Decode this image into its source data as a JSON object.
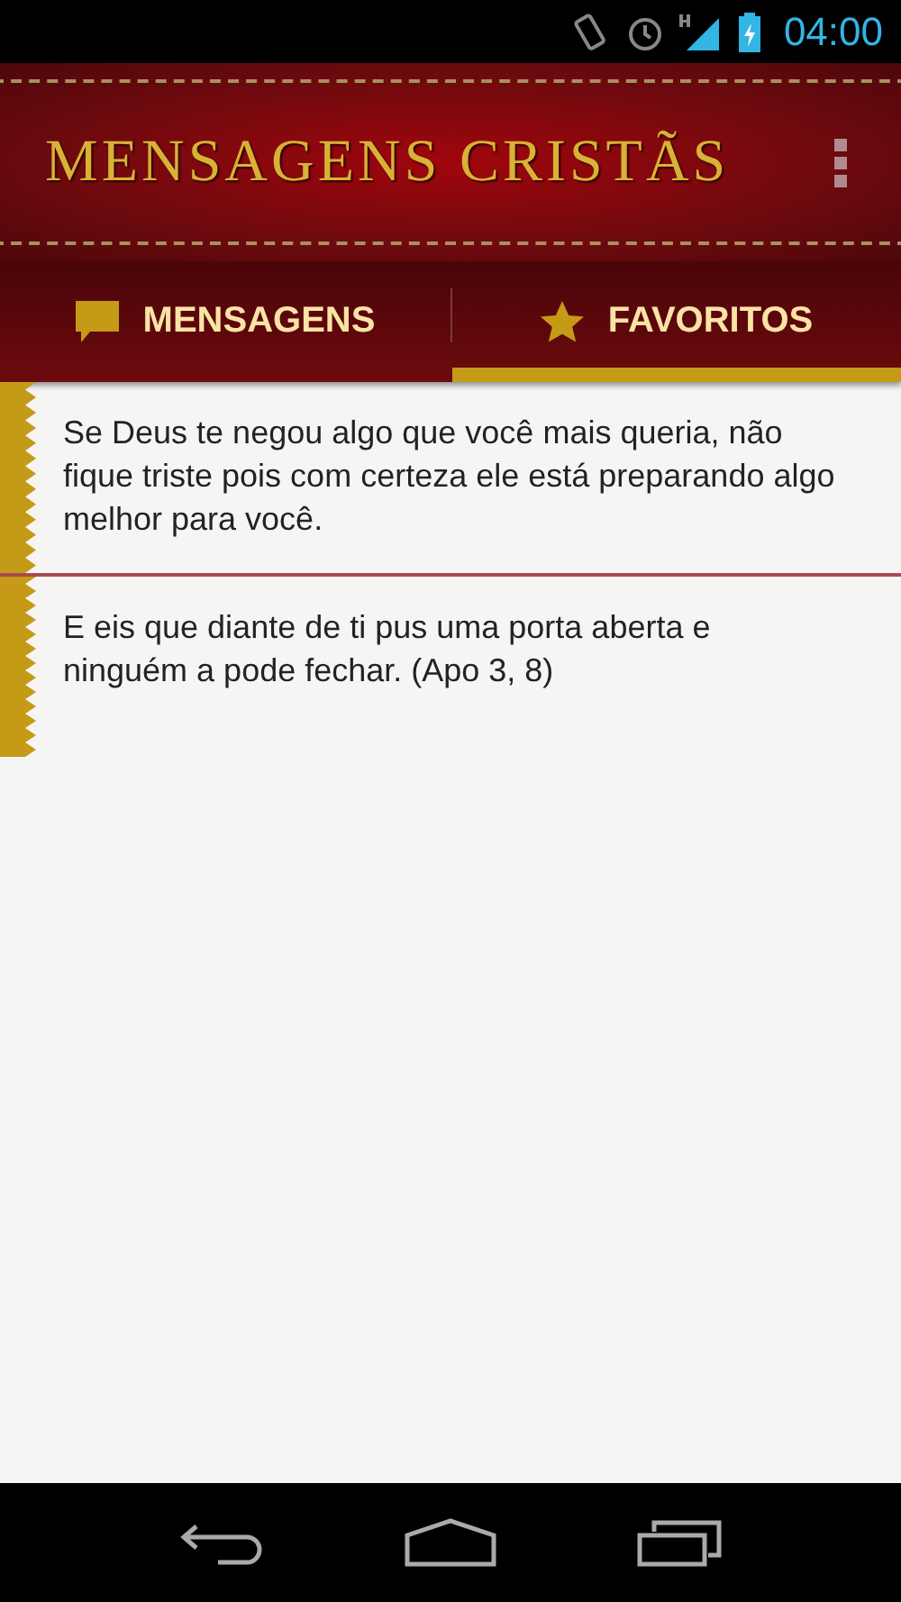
{
  "status_bar": {
    "time": "04:00"
  },
  "app_bar": {
    "title": "MENSAGENS CRISTÃS"
  },
  "tabs": [
    {
      "label": "MENSAGENS",
      "kind": "chat",
      "selected": false
    },
    {
      "label": "FAVORITOS",
      "kind": "star",
      "selected": true
    }
  ],
  "messages": [
    {
      "text": "Se Deus te negou algo que você mais queria, não fique triste pois com certeza ele está preparando algo melhor para você."
    },
    {
      "text": "E eis que diante de ti pus uma porta aberta e ninguém a pode fechar. (Apo 3, 8)"
    }
  ]
}
